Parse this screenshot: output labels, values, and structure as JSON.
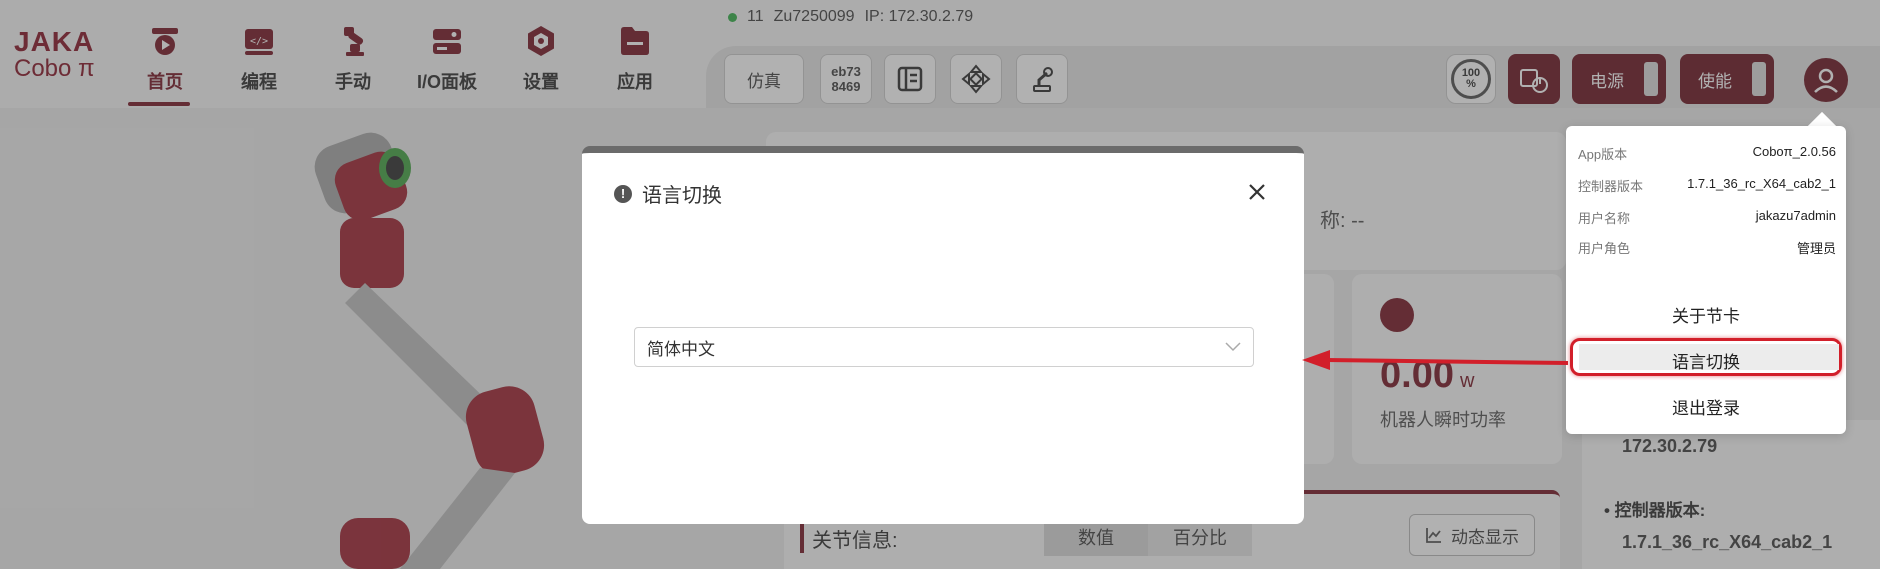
{
  "status": {
    "count": "11",
    "serial": "Zu7250099",
    "ip": "IP: 172.30.2.79"
  },
  "logo": {
    "line1": "JAKA",
    "line2": "Cobo π"
  },
  "nav": [
    {
      "label": "首页",
      "icon": "home-icon",
      "active": true
    },
    {
      "label": "编程",
      "icon": "code-icon"
    },
    {
      "label": "手动",
      "icon": "robot-arm-icon"
    },
    {
      "label": "I/O面板",
      "icon": "io-panel-icon"
    },
    {
      "label": "设置",
      "icon": "settings-hex-icon"
    },
    {
      "label": "应用",
      "icon": "app-folder-icon"
    }
  ],
  "toolbar": {
    "simulate": "仿真",
    "code_line1": "eb73",
    "code_line2": "8469",
    "speed_top": "100",
    "speed_bottom": "%",
    "power": "电源",
    "enable": "使能"
  },
  "background": {
    "name_partial": "称: --",
    "power_value": "0.00",
    "power_unit": "w",
    "power_label": "机器人瞬时功率",
    "joint_label": "关节信息:",
    "seg_value": "数值",
    "seg_percent": "百分比",
    "dynamic": "动态显示",
    "ip": "172.30.2.79",
    "ctrl_label": "• 控制器版本:",
    "ctrl_value": "1.7.1_36_rc_X64_cab2_1"
  },
  "dialog": {
    "title": "语言切换",
    "selected_language": "简体中文"
  },
  "menu": {
    "rows": [
      {
        "k": "App版本",
        "v": "Coboπ_2.0.56"
      },
      {
        "k": "控制器版本",
        "v": "1.7.1_36_rc_X64_cab2_1"
      },
      {
        "k": "用户名称",
        "v": "jakazu7admin"
      },
      {
        "k": "用户角色",
        "v": "管理员"
      }
    ],
    "about": "关于节卡",
    "language": "语言切换",
    "logout": "退出登录"
  },
  "colors": {
    "brand": "#7a1d2a",
    "annotation": "#d21f2a"
  }
}
